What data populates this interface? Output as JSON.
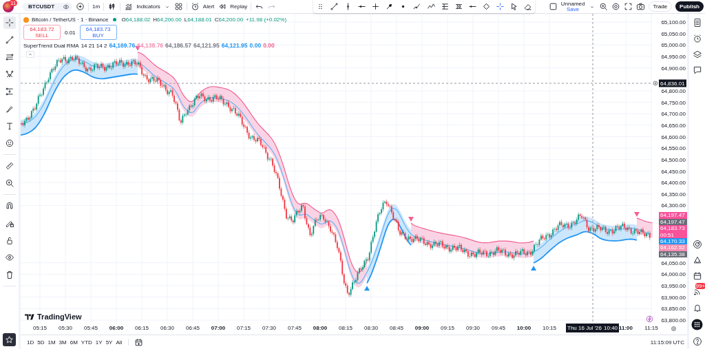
{
  "top_bar": {
    "notification_badge": "11",
    "symbol": "BTCUSDT",
    "interval": "1m",
    "indicators_label": "Indicators",
    "alert_label": "Alert",
    "replay_label": "Replay",
    "layout_name": "Unnamed",
    "layout_status": "Save",
    "trade_label": "Trade",
    "publish_label": "Publish"
  },
  "drawing_toolbar": {
    "tools": [
      {
        "selected": false
      },
      {
        "selected": false
      },
      {
        "selected": false
      },
      {
        "selected": false
      },
      {
        "selected": false
      },
      {
        "selected": false
      },
      {
        "selected": false
      },
      {
        "selected": false
      },
      {
        "selected": false
      },
      {
        "selected": false
      },
      {
        "selected": false
      },
      {
        "selected": false
      },
      {
        "selected": true
      },
      {
        "selected": false
      },
      {
        "selected": false
      }
    ]
  },
  "left_toolbar": {
    "tools": [
      {
        "selected": true
      },
      {
        "selected": false
      },
      {
        "selected": false
      },
      {
        "selected": false
      },
      {
        "selected": false
      },
      {
        "selected": false
      },
      {
        "selected": false
      },
      {
        "selected": false
      },
      {
        "selected": false
      },
      {
        "selected": false
      },
      {
        "selected": false
      },
      {
        "selected": false
      },
      {
        "selected": false
      },
      {
        "selected": false
      },
      {
        "selected": false
      }
    ]
  },
  "legend": {
    "title": "Bitcoin / TetherUS · 1 · Binance",
    "ohlc": [
      {
        "label": "O",
        "value": "64,188.02"
      },
      {
        "label": "H",
        "value": "64,200.00"
      },
      {
        "label": "L",
        "value": "64,188.01"
      },
      {
        "label": "C",
        "value": "64,200.00"
      }
    ],
    "change": "+11.98 (+0.02%)"
  },
  "order_buttons": {
    "sell_price": "64,183.72",
    "sell_label": "SELL",
    "spread": "0.01",
    "buy_price": "64,183.73",
    "buy_label": "BUY"
  },
  "indicator": {
    "name": "SuperTrend Dual RMA",
    "params": "14 21 14 2",
    "values": [
      {
        "text": "64,169.76",
        "color": "#2196f3"
      },
      {
        "text": "64,138.76",
        "color": "#f48fb1"
      },
      {
        "text": "64,186.57",
        "color": "#787b86"
      },
      {
        "text": "64,121.95",
        "color": "#787b86"
      },
      {
        "text": "64,121.95",
        "color": "#2196f3"
      },
      {
        "text": "0.00",
        "color": "#2196f3"
      },
      {
        "text": "0.00",
        "color": "#f06292"
      }
    ]
  },
  "chart_logo": "TradingView",
  "price_axis": {
    "labels": [
      "65,100.00",
      "65,050.00",
      "65,000.00",
      "64,950.00",
      "64,900.00",
      "64,800.00",
      "64,750.00",
      "64,700.00",
      "64,650.00",
      "64,600.00",
      "64,550.00",
      "64,500.00",
      "64,450.00",
      "64,400.00",
      "64,350.00",
      "64,300.00",
      "64,050.00",
      "64,000.00",
      "63,950.00",
      "63,900.00",
      "63,850.00",
      "63,800.00"
    ],
    "crosshair_label": "64,836.01",
    "badges": [
      {
        "text": "64,197.47",
        "color": "#f7529a"
      },
      {
        "text": "64,197.47",
        "color": "#6a6d78"
      },
      {
        "text": "64,183.73",
        "sub": "00:51",
        "color": "#f7529a"
      },
      {
        "text": "64,170.33",
        "color": "#2196f3"
      },
      {
        "text": "64,162.52",
        "color": "#f48fb1"
      },
      {
        "text": "64,135.38",
        "color": "#6a6d78"
      }
    ]
  },
  "time_axis": {
    "labels": [
      {
        "text": "05:15",
        "major": false
      },
      {
        "text": "05:30",
        "major": false
      },
      {
        "text": "05:45",
        "major": false
      },
      {
        "text": "06:00",
        "major": true
      },
      {
        "text": "06:15",
        "major": false
      },
      {
        "text": "06:30",
        "major": false
      },
      {
        "text": "06:45",
        "major": false
      },
      {
        "text": "07:00",
        "major": true
      },
      {
        "text": "07:15",
        "major": false
      },
      {
        "text": "07:30",
        "major": false
      },
      {
        "text": "07:45",
        "major": false
      },
      {
        "text": "08:00",
        "major": true
      },
      {
        "text": "08:15",
        "major": false
      },
      {
        "text": "08:30",
        "major": false
      },
      {
        "text": "08:45",
        "major": false
      },
      {
        "text": "09:00",
        "major": true
      },
      {
        "text": "09:15",
        "major": false
      },
      {
        "text": "09:30",
        "major": false
      },
      {
        "text": "09:45",
        "major": false
      },
      {
        "text": "10:00",
        "major": true
      },
      {
        "text": "10:15",
        "major": false
      },
      {
        "text": "11:00",
        "major": true
      },
      {
        "text": "11:15",
        "major": false
      }
    ],
    "crosshair_date": "Thu 16 Jul '26",
    "crosshair_time": "10:40"
  },
  "range_bar": {
    "ranges": [
      "1D",
      "5D",
      "1M",
      "3M",
      "6M",
      "YTD",
      "1Y",
      "5Y",
      "All"
    ],
    "clock": "11:15:09 UTC"
  },
  "right_sidebar": {
    "news_badge": "99+"
  }
}
